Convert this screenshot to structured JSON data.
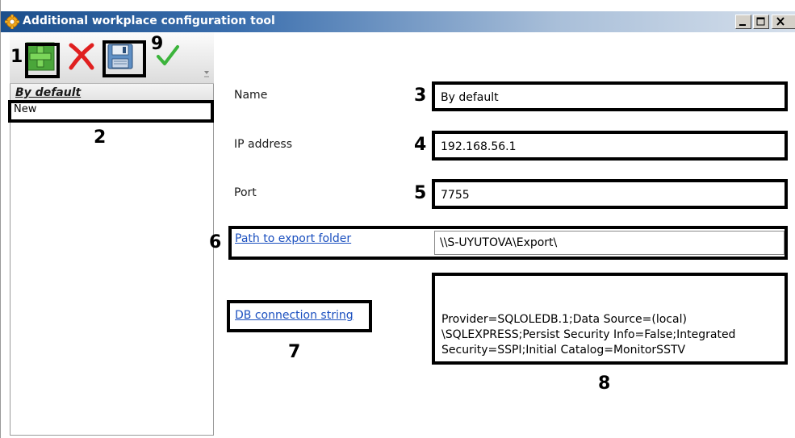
{
  "window": {
    "title": "Additional workplace configuration tool",
    "icon": "gear-icon",
    "controls": [
      "minimize-icon",
      "maximize-icon",
      "close-icon"
    ]
  },
  "toolbar": {
    "buttons": [
      {
        "name": "add",
        "icon": "plus-icon"
      },
      {
        "name": "delete",
        "icon": "x-icon"
      },
      {
        "name": "save",
        "icon": "floppy-disk-icon"
      },
      {
        "name": "apply",
        "icon": "checkmark-icon"
      }
    ]
  },
  "list": {
    "header": "By default",
    "items": [
      "New"
    ]
  },
  "form": {
    "name_label": "Name",
    "name_value": "By default",
    "ip_label": "IP address",
    "ip_value": "192.168.56.1",
    "port_label": "Port",
    "port_value": "7755",
    "export_link": "Path to export folder",
    "export_value": "\\\\S-UYUTOVA\\Export\\",
    "db_link": "DB connection string",
    "db_value": "Provider=SQLOLEDB.1;Data Source=(local)\n\\SQLEXPRESS;Persist Security Info=False;Integrated\nSecurity=SSPI;Initial Catalog=MonitorSSTV"
  },
  "markers": {
    "m1": "1",
    "m2": "2",
    "m3": "3",
    "m4": "4",
    "m5": "5",
    "m6": "6",
    "m7": "7",
    "m8": "8",
    "m9": "9"
  },
  "colors": {
    "title_start": "#1c4f8c",
    "link": "#1a4fbf",
    "add_green": "#3aa829",
    "delete_red": "#e02020",
    "check_green": "#3cb43c",
    "highlight": "#000000"
  }
}
